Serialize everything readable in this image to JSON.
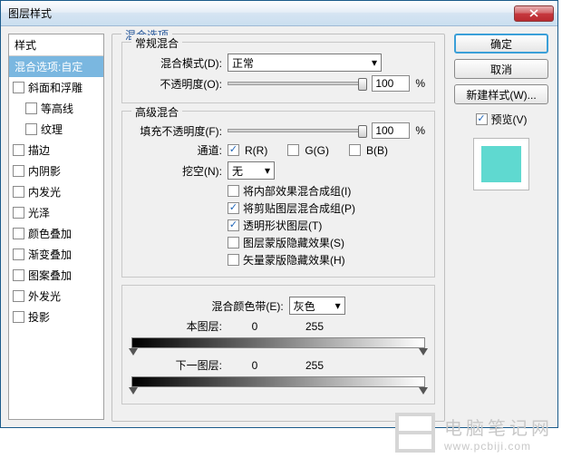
{
  "title": "图层样式",
  "left": {
    "header": "样式",
    "selected": "混合选项:自定",
    "items": [
      {
        "label": "斜面和浮雕",
        "checked": false,
        "indent": false
      },
      {
        "label": "等高线",
        "checked": false,
        "indent": true
      },
      {
        "label": "纹理",
        "checked": false,
        "indent": true
      },
      {
        "label": "描边",
        "checked": false,
        "indent": false
      },
      {
        "label": "内阴影",
        "checked": false,
        "indent": false
      },
      {
        "label": "内发光",
        "checked": false,
        "indent": false
      },
      {
        "label": "光泽",
        "checked": false,
        "indent": false
      },
      {
        "label": "颜色叠加",
        "checked": false,
        "indent": false
      },
      {
        "label": "渐变叠加",
        "checked": false,
        "indent": false
      },
      {
        "label": "图案叠加",
        "checked": false,
        "indent": false
      },
      {
        "label": "外发光",
        "checked": false,
        "indent": false
      },
      {
        "label": "投影",
        "checked": false,
        "indent": false
      }
    ]
  },
  "mid": {
    "group_title": "混合选项",
    "general": {
      "title": "常规混合",
      "blend_mode_label": "混合模式(D):",
      "blend_mode_value": "正常",
      "opacity_label": "不透明度(O):",
      "opacity_value": "100",
      "pct": "%"
    },
    "advanced": {
      "title": "高级混合",
      "fill_label": "填充不透明度(F):",
      "fill_value": "100",
      "pct": "%",
      "channel_label": "通道:",
      "ch_r": "R(R)",
      "ch_g": "G(G)",
      "ch_b": "B(B)",
      "knockout_label": "挖空(N):",
      "knockout_value": "无",
      "opts": [
        {
          "label": "将内部效果混合成组(I)",
          "checked": false
        },
        {
          "label": "将剪贴图层混合成组(P)",
          "checked": true
        },
        {
          "label": "透明形状图层(T)",
          "checked": true
        },
        {
          "label": "图层蒙版隐藏效果(S)",
          "checked": false
        },
        {
          "label": "矢量蒙版隐藏效果(H)",
          "checked": false
        }
      ]
    },
    "blendif": {
      "label": "混合颜色带(E):",
      "value": "灰色",
      "this_label": "本图层:",
      "this_lo": "0",
      "this_hi": "255",
      "under_label": "下一图层:",
      "under_lo": "0",
      "under_hi": "255"
    }
  },
  "right": {
    "ok": "确定",
    "cancel": "取消",
    "new_style": "新建样式(W)...",
    "preview_label": "预览(V)",
    "preview_color": "#5fd9d0"
  },
  "brand": {
    "cn": "电脑笔记网",
    "en": "www.pcbiji.com"
  }
}
